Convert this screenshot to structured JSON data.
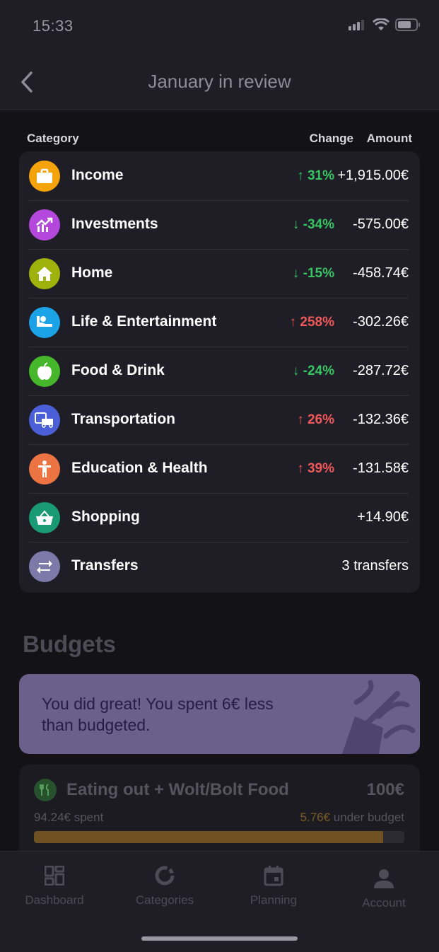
{
  "status": {
    "time": "15:33"
  },
  "nav": {
    "title": "January in review"
  },
  "columns": {
    "category": "Category",
    "change": "Change",
    "amount": "Amount"
  },
  "categories": [
    {
      "name": "Income",
      "change": "↑ 31%",
      "trend": "up-green",
      "amount": "+1,915.00€",
      "icon": "briefcase-icon",
      "color": "#f5a30b"
    },
    {
      "name": "Investments",
      "change": "↓ -34%",
      "trend": "down-green",
      "amount": "-575.00€",
      "icon": "chart-trend-icon",
      "color": "#b548dc"
    },
    {
      "name": "Home",
      "change": "↓ -15%",
      "trend": "down-green",
      "amount": "-458.74€",
      "icon": "house-icon",
      "color": "#9fb10b"
    },
    {
      "name": "Life & Entertainment",
      "change": "↑ 258%",
      "trend": "up-red",
      "amount": "-302.26€",
      "icon": "person-relax-icon",
      "color": "#1ca2e6"
    },
    {
      "name": "Food & Drink",
      "change": "↓ -24%",
      "trend": "down-green",
      "amount": "-287.72€",
      "icon": "apple-icon",
      "color": "#46b62a"
    },
    {
      "name": "Transportation",
      "change": "↑ 26%",
      "trend": "up-red",
      "amount": "-132.36€",
      "icon": "car-bus-icon",
      "color": "#4a5fd8"
    },
    {
      "name": "Education & Health",
      "change": "↑ 39%",
      "trend": "up-red",
      "amount": "-131.58€",
      "icon": "person-icon",
      "color": "#ec7443"
    },
    {
      "name": "Shopping",
      "change": "",
      "trend": "",
      "amount": "+14.90€",
      "icon": "basket-icon",
      "color": "#1a9a74"
    },
    {
      "name": "Transfers",
      "change": "",
      "trend": "",
      "amount": "3 transfers",
      "icon": "swap-arrows-icon",
      "color": "#7d79a9"
    }
  ],
  "budgets": {
    "title": "Budgets",
    "banner": "You did great! You spent 6€ less than budgeted.",
    "item": {
      "name": "Eating out + Wolt/Bolt Food",
      "total": "100€",
      "spent": "94.24€ spent",
      "under_amount": "5.76€",
      "under_label": " under budget",
      "progress_fraction": 0.9424
    }
  },
  "tabs": [
    {
      "label": "Dashboard",
      "icon": "dashboard-icon"
    },
    {
      "label": "Categories",
      "icon": "donut-icon"
    },
    {
      "label": "Planning",
      "icon": "calendar-icon"
    },
    {
      "label": "Account",
      "icon": "account-icon"
    }
  ]
}
